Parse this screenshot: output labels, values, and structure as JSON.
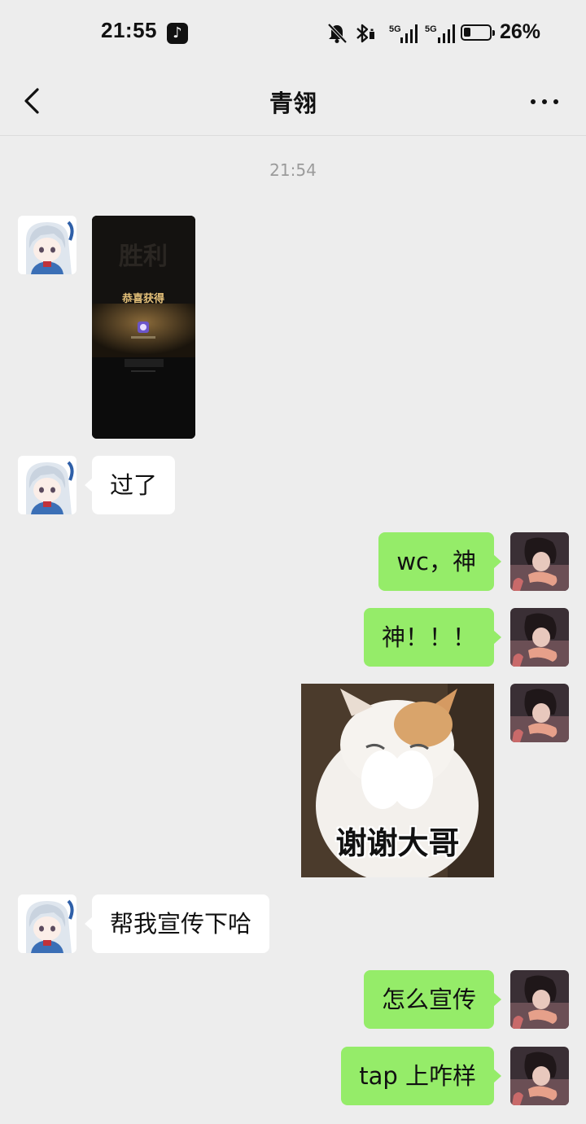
{
  "status_bar": {
    "time": "21:55",
    "battery_percent": "26%",
    "battery_level": 0.26,
    "network_label_1": "5G",
    "network_label_2": "5G",
    "icons": [
      "tiktok-icon",
      "mute-bell-icon",
      "bluetooth-icon",
      "signal-icon",
      "signal-icon",
      "battery-icon"
    ]
  },
  "header": {
    "title": "青翎",
    "back_icon": "chevron-left-icon",
    "more_icon": "more-dots-icon"
  },
  "chat": {
    "timestamp": "21:54",
    "screenshot_title": "胜利",
    "screenshot_caption": "恭喜获得",
    "messages": [
      {
        "from": "other",
        "type": "image"
      },
      {
        "from": "other",
        "type": "text",
        "text": "过了"
      },
      {
        "from": "me",
        "type": "text",
        "text": "wc，神"
      },
      {
        "from": "me",
        "type": "text",
        "text": "神！！！"
      },
      {
        "from": "me",
        "type": "sticker",
        "text": "谢谢大哥"
      },
      {
        "from": "other",
        "type": "text",
        "text": "帮我宣传下哈"
      },
      {
        "from": "me",
        "type": "text",
        "text": "怎么宣传"
      },
      {
        "from": "me",
        "type": "text",
        "text": "tap 上咋样"
      }
    ]
  },
  "colors": {
    "background": "#ededed",
    "outgoing_bubble": "#95ec69",
    "incoming_bubble": "#ffffff",
    "timestamp_text": "#9b9b9b"
  }
}
